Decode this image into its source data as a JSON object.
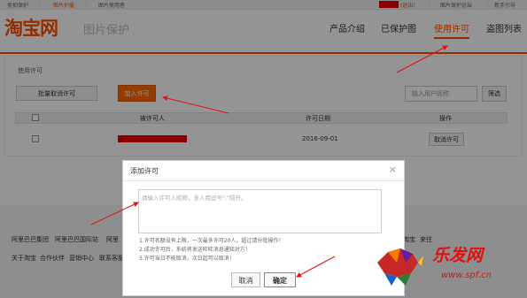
{
  "topbar": {
    "item1": "卖拍保护",
    "item2": "图片护盾",
    "item3": "图片使用者",
    "logout": "(退出)",
    "forum": "图片保护论坛",
    "guide": "新手引导"
  },
  "header": {
    "logo": "淘宝网",
    "subtitle": "图片保护",
    "nav": [
      "产品介绍",
      "已保护图",
      "使用许可",
      "盗图列表"
    ],
    "active_nav": "使用许可"
  },
  "panel": {
    "section_label": "使用许可",
    "batch_cancel": "批量取消许可",
    "add_permission": "加入许可",
    "search_placeholder": "输入用户昵称",
    "filter": "筛选",
    "columns": [
      "被许可人",
      "许可日期",
      "操作"
    ],
    "rows": [
      {
        "date": "2016-09-01",
        "action": "取消许可"
      }
    ]
  },
  "footer": {
    "row1": [
      "阿里巴巴集团",
      "阿里巴巴国际站",
      "阿里",
      "淘宝",
      "来往"
    ],
    "row2": [
      "关于淘宝",
      "合作伙伴",
      "营销中心",
      "联系客服"
    ]
  },
  "dialog": {
    "title": "添加许可",
    "close": "×",
    "placeholder": "请输入许可人昵称，多人用逗号\",\"隔开。",
    "notes": [
      "1.许可名额没有上限，一次最多许可20人，超过请分批操作！",
      "2.成功许可后，系统将发送旺旺消息通知对方！",
      "3.许可当日不能取消，次日起可以取消！"
    ],
    "cancel": "取消",
    "confirm": "确定"
  },
  "watermark": {
    "brand": "乐发网",
    "url": "www.spf.cn"
  },
  "colors": {
    "brand": "#ff5000",
    "annotation": "#e21111"
  }
}
